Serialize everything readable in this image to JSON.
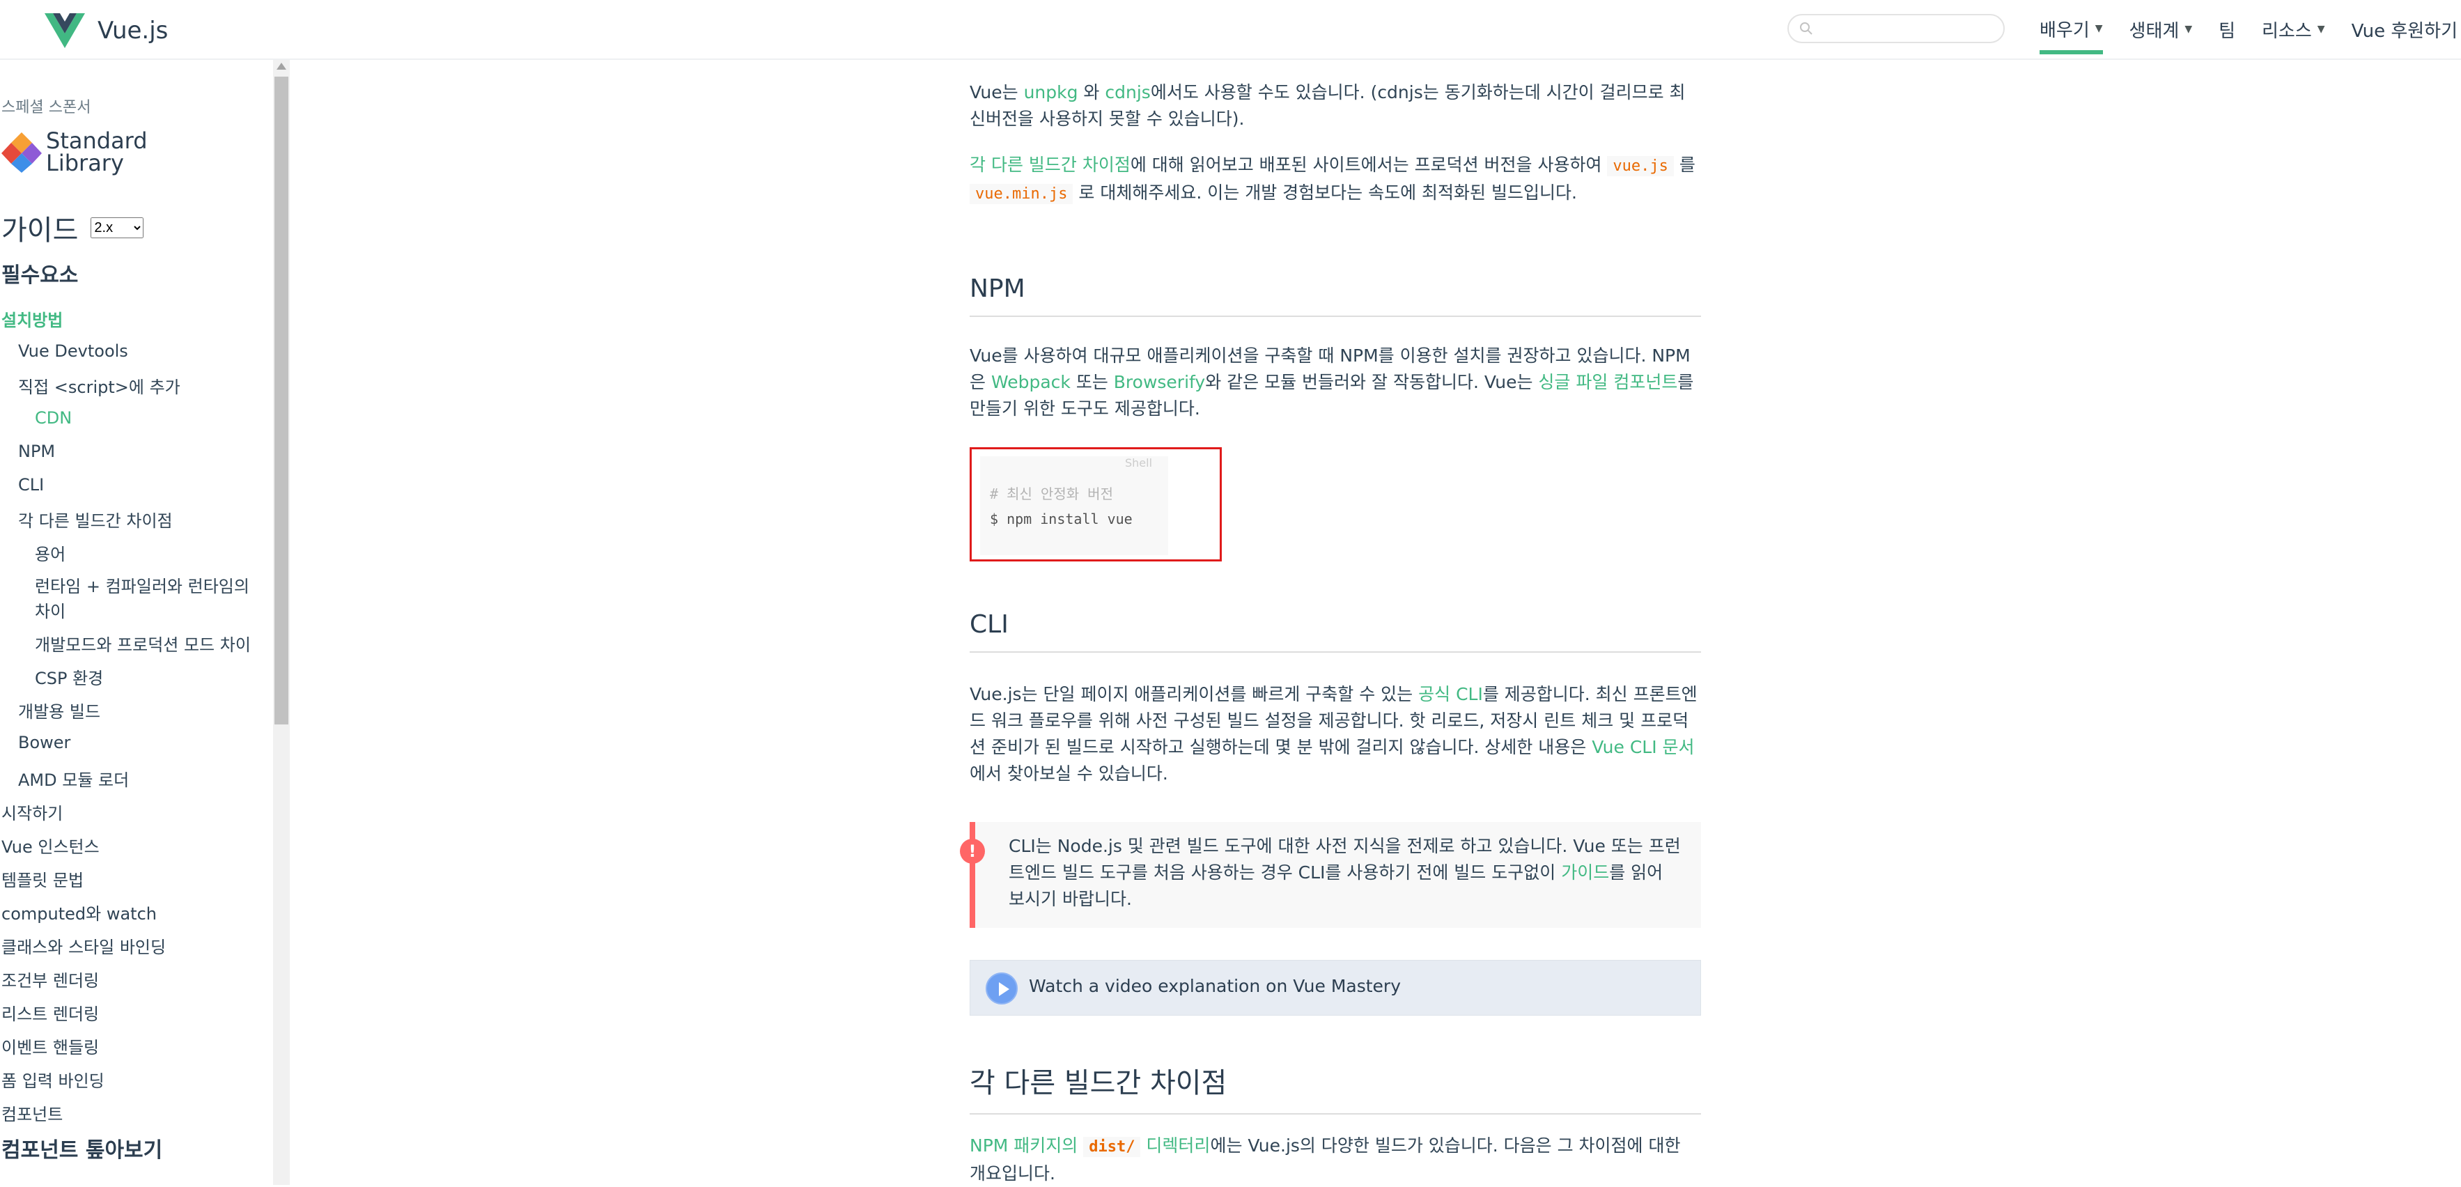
{
  "header": {
    "logo_text": "Vue.js",
    "search_placeholder": "",
    "nav": [
      {
        "label": "배우기",
        "dropdown": true,
        "active": true
      },
      {
        "label": "생태계",
        "dropdown": true
      },
      {
        "label": "팀",
        "dropdown": false
      },
      {
        "label": "리소스",
        "dropdown": true
      },
      {
        "label": "Vue 후원하기",
        "dropdown": true
      }
    ]
  },
  "sidebar": {
    "sponsor_label": "스페셜 스폰서",
    "sponsor_name_line1": "Standard",
    "sponsor_name_line2": "Library",
    "guide_title": "가이드",
    "version_selected": "2.x",
    "section_essentials": "필수요소",
    "items": [
      {
        "label": "설치방법"
      },
      {
        "label": "Vue Devtools"
      },
      {
        "label": "직접 <script>에 추가"
      },
      {
        "label": "CDN"
      },
      {
        "label": "NPM"
      },
      {
        "label": "CLI"
      },
      {
        "label": "각 다른 빌드간 차이점"
      },
      {
        "label": "용어"
      },
      {
        "label": "런타임 + 컴파일러와 런타임의"
      },
      {
        "label": "차이"
      },
      {
        "label": "개발모드와 프로덕션 모드 차이"
      },
      {
        "label": "CSP 환경"
      },
      {
        "label": "개발용 빌드"
      },
      {
        "label": "Bower"
      },
      {
        "label": "AMD 모듈 로더"
      },
      {
        "label": "시작하기"
      },
      {
        "label": "Vue 인스턴스"
      },
      {
        "label": "템플릿 문법"
      },
      {
        "label": "computed와 watch"
      },
      {
        "label": "클래스와 스타일 바인딩"
      },
      {
        "label": "조건부 렌더링"
      },
      {
        "label": "리스트 렌더링"
      },
      {
        "label": "이벤트 핸들링"
      },
      {
        "label": "폼 입력 바인딩"
      },
      {
        "label": "컴포넌트"
      }
    ],
    "section_components": "컴포넌트 톺아보기"
  },
  "content": {
    "p1": {
      "pre": "Vue는 ",
      "link1": "unpkg",
      "mid1": " 와 ",
      "link2": "cdnjs",
      "post": "에서도 사용할 수도 있습니다. (cdnjs는 동기화하는데 시간이 걸리므로 최신버전을 사용하지 못할 수 있습니다)."
    },
    "p2": {
      "link": "각 다른 빌드간 차이점",
      "mid1": "에 대해 읽어보고 배포된 사이트에서는 프로덕션 버전을 사용하여 ",
      "code1": "vue.js",
      "mid2": " 를 ",
      "code2": "vue.min.js",
      "post": " 로 대체해주세요. 이는 개발 경험보다는 속도에 최적화된 빌드입니다."
    },
    "npm_heading": "NPM",
    "p3": {
      "pre": "Vue를 사용하여 대규모 애플리케이션을 구축할 때 NPM를 이용한 설치를 권장하고 있습니다. NPM은 ",
      "link1": "Webpack",
      "mid1": " 또는 ",
      "link2": "Browserify",
      "mid2": "와 같은 모듈 번들러와 잘 작동합니다. Vue는 ",
      "link3": "싱글 파일 컴포넌트",
      "post": "를 만들기 위한 도구도 제공합니다."
    },
    "code": {
      "lang": "Shell",
      "line1": "# 최신 안정화 버전",
      "line2": "$ npm install vue"
    },
    "cli_heading": "CLI",
    "p4": {
      "pre": "Vue.js는 단일 페이지 애플리케이션를 빠르게 구축할 수 있는 ",
      "link1": "공식 CLI",
      "mid": "를 제공합니다. 최신 프론트엔드 워크 플로우를 위해 사전 구성된 빌드 설정을 제공합니다. 핫 리로드, 저장시 린트 체크 및 프로덕션 준비가 된 빌드로 시작하고 실행하는데 몇 분 밖에 걸리지 않습니다. 상세한 내용은 ",
      "link2": "Vue CLI 문서",
      "post": "에서 찾아보실 수 있습니다."
    },
    "tip": {
      "icon": "!",
      "pre": "CLI는 Node.js 및 관련 빌드 도구에 대한 사전 지식을 전제로 하고 있습니다. Vue 또는 프런트엔드 빌드 도구를 처음 사용하는 경우 CLI를 사용하기 전에 빌드 도구없이 ",
      "link": "가이드",
      "post": "를 읽어 보시기 바랍니다."
    },
    "video_label": "Watch a video explanation on Vue Mastery",
    "builds_heading": "각 다른 빌드간 차이점",
    "p5": {
      "link1": "NPM 패키지의 ",
      "code": "dist/",
      "link2": " 디렉터리",
      "post": "에는 Vue.js의 다양한 빌드가 있습니다. 다음은 그 차이점에 대한 개요입니다."
    }
  },
  "colors": {
    "accent": "#42b983",
    "text": "#304455",
    "heading": "#2c3e50",
    "code": "#e96900",
    "danger": "#ff6666",
    "highlight_border": "#e01b1b"
  }
}
